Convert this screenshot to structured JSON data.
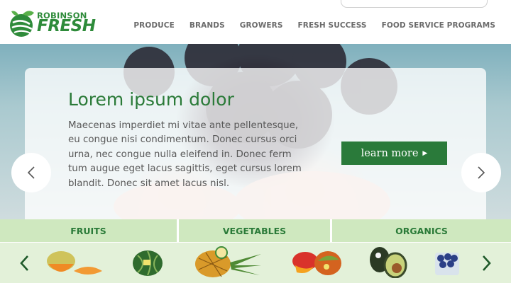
{
  "brand": {
    "line1": "ROBINSON",
    "line2": "FRESH",
    "green": "#2e8b3a"
  },
  "nav": {
    "items": [
      {
        "label": "PRODUCE"
      },
      {
        "label": "BRANDS"
      },
      {
        "label": "GROWERS"
      },
      {
        "label": "FRESH SUCCESS"
      },
      {
        "label": "FOOD SERVICE PROGRAMS"
      }
    ]
  },
  "hero": {
    "title": "Lorem ipsum dolor",
    "body": "Maecenas imperdiet mi vitae ante pellentesque, eu congue nisi condimentum. Donec cursus orci urna, nec congue nulla eleifend in. Donec ferm tum augue eget lacus sagittis, eget cursus lorem blandit. Donec sit amet lacus nisl.",
    "cta_label": "learn more",
    "cta_color": "#2a7a3a"
  },
  "categories": {
    "tabs": [
      {
        "label": "FRUITS"
      },
      {
        "label": "VEGETABLES"
      },
      {
        "label": "ORGANICS"
      }
    ],
    "tab_color": "#cfe8bf"
  },
  "products": [
    {
      "icon": "cantaloupe-icon"
    },
    {
      "icon": "watermelon-icon"
    },
    {
      "icon": "pineapple-icon"
    },
    {
      "icon": "mango-icon"
    },
    {
      "icon": "avocado-icon"
    },
    {
      "icon": "blueberries-icon"
    }
  ]
}
